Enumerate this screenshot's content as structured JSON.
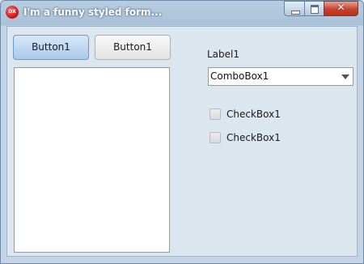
{
  "window": {
    "title": "I'm a funny styled form...",
    "app_icon_text": "DX",
    "close_glyph": "✕"
  },
  "buttons": {
    "button1_label": "Button1",
    "button2_label": "Button1"
  },
  "label1": "Label1",
  "combo": {
    "value": "ComboBox1"
  },
  "checkboxes": [
    {
      "label": "CheckBox1",
      "checked": false
    },
    {
      "label": "CheckBox1",
      "checked": false
    }
  ],
  "colors": {
    "title_accent": "#a9c1d8",
    "client_bg": "#dce6ef",
    "close_button": "#c7432c",
    "primary_button": "#a9c9ea"
  }
}
